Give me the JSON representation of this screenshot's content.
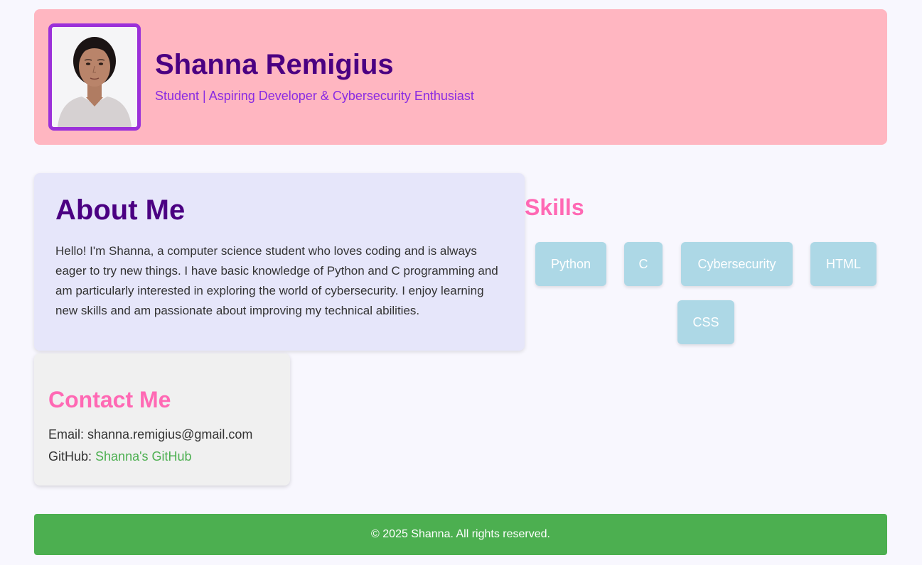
{
  "header": {
    "name": "Shanna Remigius",
    "tagline": "Student | Aspiring Developer & Cybersecurity Enthusiast"
  },
  "about": {
    "title": "About Me",
    "text": "Hello! I'm Shanna, a computer science student who loves coding and is always eager to try new things. I have basic knowledge of Python and C programming and am particularly interested in exploring the world of cybersecurity. I enjoy learning new skills and am passionate about improving my technical abilities."
  },
  "skills": {
    "title": "Skills",
    "items": [
      "Python",
      "C",
      "Cybersecurity",
      "HTML",
      "CSS"
    ]
  },
  "contact": {
    "title": "Contact Me",
    "email_label": "Email: ",
    "email": "shanna.remigius@gmail.com",
    "github_label": "GitHub: ",
    "github_link": "Shanna's GitHub"
  },
  "footer": {
    "text": "© 2025 Shanna. All rights reserved."
  },
  "colors": {
    "header_bg": "#ffb6c1",
    "name": "#4b0082",
    "tagline": "#8a2be2",
    "about_bg": "#e6e6fa",
    "skills_title": "#ff69b4",
    "skill_bg": "#add8e6",
    "link": "#4caf50",
    "footer_bg": "#4caf50"
  }
}
